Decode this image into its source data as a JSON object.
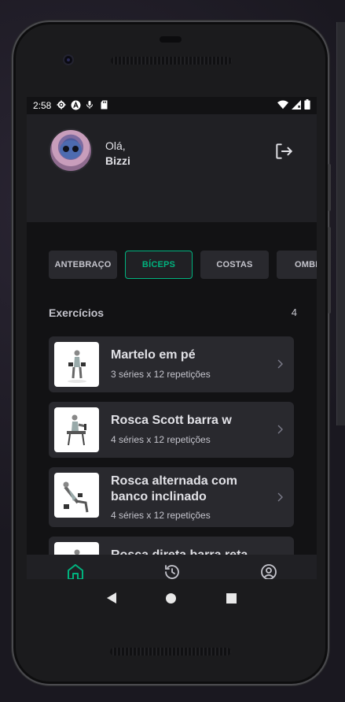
{
  "status_bar": {
    "time": "2:58"
  },
  "header": {
    "greeting": "Olá,",
    "user_name": "Bizzi"
  },
  "muscle_groups": [
    {
      "label": "ANTEBRAÇO",
      "active": false
    },
    {
      "label": "BÍCEPS",
      "active": true
    },
    {
      "label": "COSTAS",
      "active": false
    },
    {
      "label": "OMBRO",
      "active": false
    }
  ],
  "exercises_section": {
    "title": "Exercícios",
    "count": "4"
  },
  "exercises": [
    {
      "name": "Martelo em pé",
      "detail": "3 séries x 12 repetições"
    },
    {
      "name": "Rosca Scott barra w",
      "detail": "4 séries x 12 repetições"
    },
    {
      "name_line1": "Rosca alternada com",
      "name_line2": "banco inclinado",
      "detail": "4 séries x 12 repetições"
    },
    {
      "name": "Rosca direta barra reta",
      "detail": ""
    }
  ],
  "tab_bar": {
    "icons": [
      "home-icon",
      "history-icon",
      "profile-icon"
    ],
    "active": "home-icon"
  },
  "colors": {
    "accent": "#00b37e",
    "background": "#121214",
    "card": "#29292e",
    "header": "#202024",
    "text": "#e1e1e6",
    "muted": "#c4c4cc"
  }
}
